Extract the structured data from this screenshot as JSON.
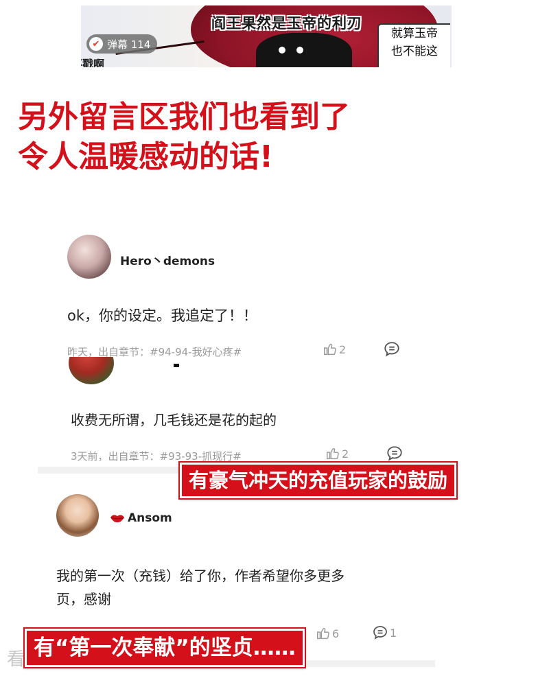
{
  "comic": {
    "caption": "阎王果然是玉帝的利刃",
    "bubble_lines": [
      "就算玉帝",
      "也不能这"
    ],
    "danmu_label": "弹幕 114",
    "fragment": "不戳啊"
  },
  "banners": {
    "headline_line1": "另外留言区我们也看到了",
    "headline_line2": "令人温暖感动的话!",
    "recharge": "有豪气冲天的充值玩家的鼓励",
    "first_time": "有“第一次奉献”的坚贞……"
  },
  "comments": [
    {
      "user": "Hero丶demons",
      "text": "ok，你的设定。我追定了！！",
      "meta": "昨天，出自章节：#94-94-我好心疼#",
      "likes": "2"
    },
    {
      "user": "",
      "text": "收费无所谓，几毛钱还是花的起的",
      "meta": "3天前，出自章节：#93-93-抓现行#",
      "likes": "2"
    },
    {
      "user": "Ansom",
      "user_prefix_icon": "lips-icon",
      "text_line1": "我的第一次（充钱）给了你，作者希望你多更多",
      "text_line2": "页，感谢",
      "likes": "6",
      "replies": "1"
    }
  ],
  "watermark": "看漫画",
  "colors": {
    "accent_red": "#d4111b",
    "meta_gray": "#9a9a9a"
  }
}
